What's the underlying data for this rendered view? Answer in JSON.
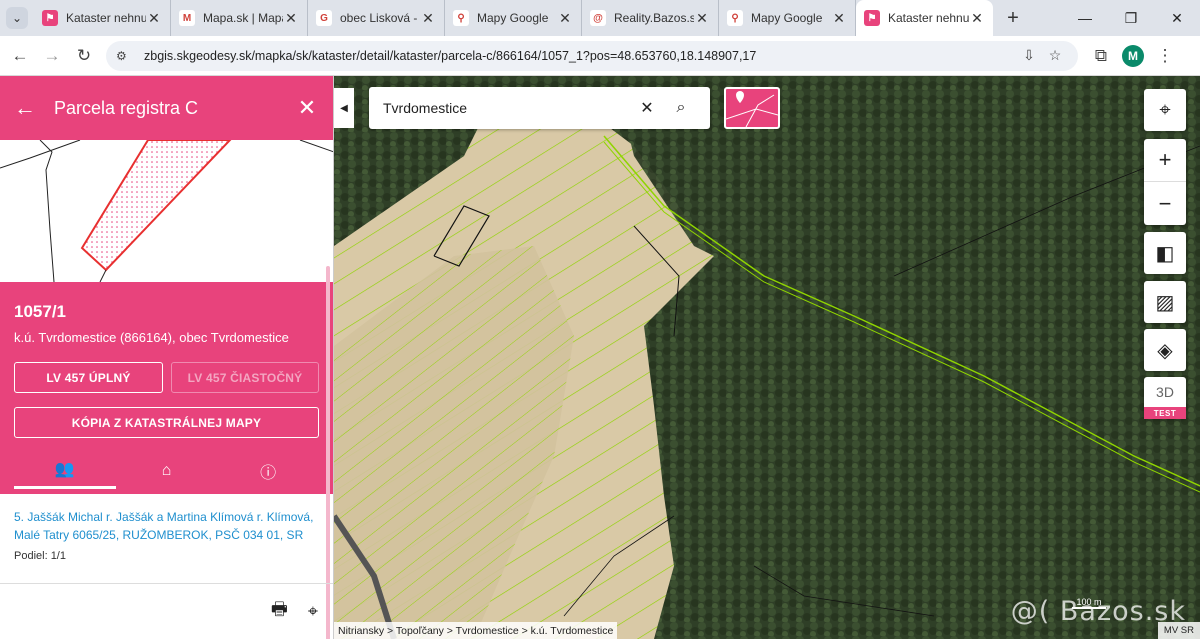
{
  "browser": {
    "tabs": [
      {
        "title": "Kataster nehnuteľ",
        "fav_color": "#e8437c",
        "fav_glyph": "⚑",
        "active": false
      },
      {
        "title": "Mapa.sk | Mapa",
        "fav_color": "#ffffff",
        "fav_glyph": "M",
        "active": false
      },
      {
        "title": "obec Lisková - H",
        "fav_color": "#ffffff",
        "fav_glyph": "G",
        "active": false
      },
      {
        "title": "Mapy Google",
        "fav_color": "#ffffff",
        "fav_glyph": "⚲",
        "active": false
      },
      {
        "title": "Reality.Bazos.sk",
        "fav_color": "#ffffff",
        "fav_glyph": "@",
        "active": false
      },
      {
        "title": "Mapy Google",
        "fav_color": "#ffffff",
        "fav_glyph": "⚲",
        "active": false
      },
      {
        "title": "Kataster nehnuteľ",
        "fav_color": "#e8437c",
        "fav_glyph": "⚑",
        "active": true
      }
    ],
    "url": "zbgis.skgeodesy.sk/mapka/sk/kataster/detail/kataster/parcela-c/866164/1057_1?pos=48.653760,18.148907,17",
    "profile_initial": "M"
  },
  "panel": {
    "title": "Parcela registra C",
    "parcel_number": "1057/1",
    "parcel_subtitle": "k.ú. Tvrdomestice (866164), obec Tvrdomestice",
    "btn_lv_full": "LV 457 ÚPLNÝ",
    "btn_lv_partial": "LV 457 ČIASTOČNÝ",
    "btn_copy_map": "KÓPIA Z KATASTRÁLNEJ MAPY",
    "owner_text": "5. Jaššák Michal r. Jaššák a Martina Klímová r. Klímová, Malé Tatry 6065/25, RUŽOMBEROK, PSČ 034 01, SR",
    "owner_share": "Podiel: 1/1"
  },
  "map": {
    "search_value": "Tvrdomestice",
    "label_3d": "3D",
    "label_test": "TEST",
    "breadcrumb": "Nitriansky > Topoľčany > Tvrdomestice > k.ú. Tvrdomestice",
    "scale_label": "100 m",
    "attribution": "MV SR",
    "watermark": "@( Bazos.sk"
  },
  "colors": {
    "accent": "#e8437c",
    "link": "#1f8fce",
    "parcel_lines": "#8fd400"
  }
}
